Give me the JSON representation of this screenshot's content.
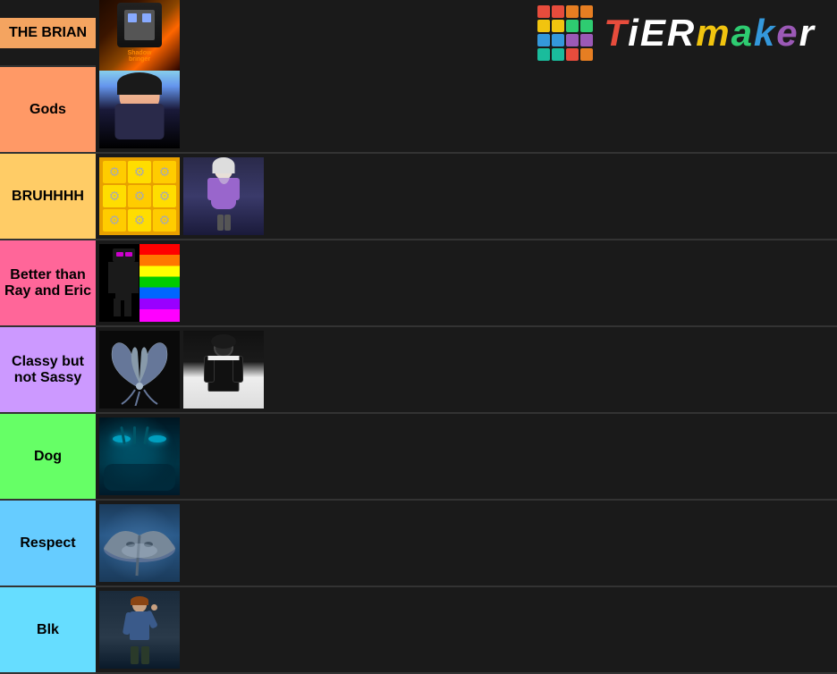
{
  "logo": {
    "text": "TiERMAKER",
    "colors": [
      "#e74c3c",
      "#f39c12",
      "#f1c40f",
      "#2ecc71",
      "#1abc9c",
      "#3498db",
      "#9b59b6",
      "#e74c3c",
      "#e67e22"
    ]
  },
  "tiers": [
    {
      "id": "the-brian",
      "label": "THE BRIAN",
      "color": "#f4a460",
      "items": [
        "shadowbringer",
        ""
      ]
    },
    {
      "id": "gods",
      "label": "Gods",
      "color": "#ff9966",
      "items": [
        "anime-guy"
      ]
    },
    {
      "id": "bruhhhh",
      "label": "BRUHHHH",
      "color": "#ffcc66",
      "items": [
        "yellow-pattern",
        "girl-character"
      ]
    },
    {
      "id": "better",
      "label": "Better than Ray and Eric",
      "color": "#ff6699",
      "items": [
        "enderman-rainbow"
      ]
    },
    {
      "id": "classy",
      "label": "Classy but not Sassy",
      "color": "#cc99ff",
      "items": [
        "wing-symbol",
        "dark-character"
      ]
    },
    {
      "id": "dog",
      "label": "Dog",
      "color": "#66ff66",
      "items": [
        "creature"
      ]
    },
    {
      "id": "respect",
      "label": "Respect",
      "color": "#66ccff",
      "items": [
        "stingray"
      ]
    },
    {
      "id": "blk",
      "label": "Blk",
      "color": "#66ddff",
      "items": [
        "person"
      ]
    }
  ]
}
